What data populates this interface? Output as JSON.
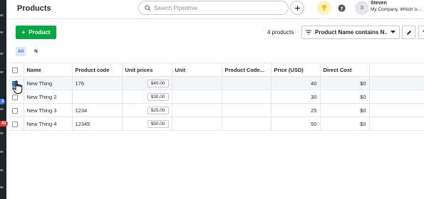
{
  "header": {
    "title": "Products",
    "search_placeholder": "Search Pipedrive",
    "user_initial": "S",
    "user_name": "Steven",
    "user_company": "My Company, Which is ..."
  },
  "rail": {
    "badges": [
      {
        "text": "3",
        "color": "#317ae2"
      },
      {
        "text": "41",
        "color": "#e03c31"
      }
    ]
  },
  "toolbar": {
    "add_label": "Product",
    "count_label": "4 products",
    "filter_label": "Product Name contains N..."
  },
  "letters": [
    "All",
    "N"
  ],
  "table": {
    "columns": [
      "Name",
      "Product code",
      "Unit prices",
      "Unit",
      "Product Code...",
      "Price (USD)",
      "Direct Cost"
    ],
    "rows": [
      {
        "name": "New Thing",
        "code": "176",
        "unit_price": "$40.00",
        "unit": "",
        "product_code2": "",
        "price": "40",
        "cost": "$0"
      },
      {
        "name": "New Thing 2",
        "code": "",
        "unit_price": "$30.00",
        "unit": "",
        "product_code2": "",
        "price": "30",
        "cost": "$0"
      },
      {
        "name": "New Thing 3",
        "code": "1234",
        "unit_price": "$25.00",
        "unit": "",
        "product_code2": "",
        "price": "25",
        "cost": "$0"
      },
      {
        "name": "New Thing 4",
        "code": "12345",
        "unit_price": "$50.00",
        "unit": "",
        "product_code2": "",
        "price": "50",
        "cost": "$0"
      }
    ]
  },
  "colors": {
    "brand_green": "#08a742",
    "accent_blue": "#317ae2",
    "rail_dark": "#1f2429"
  }
}
